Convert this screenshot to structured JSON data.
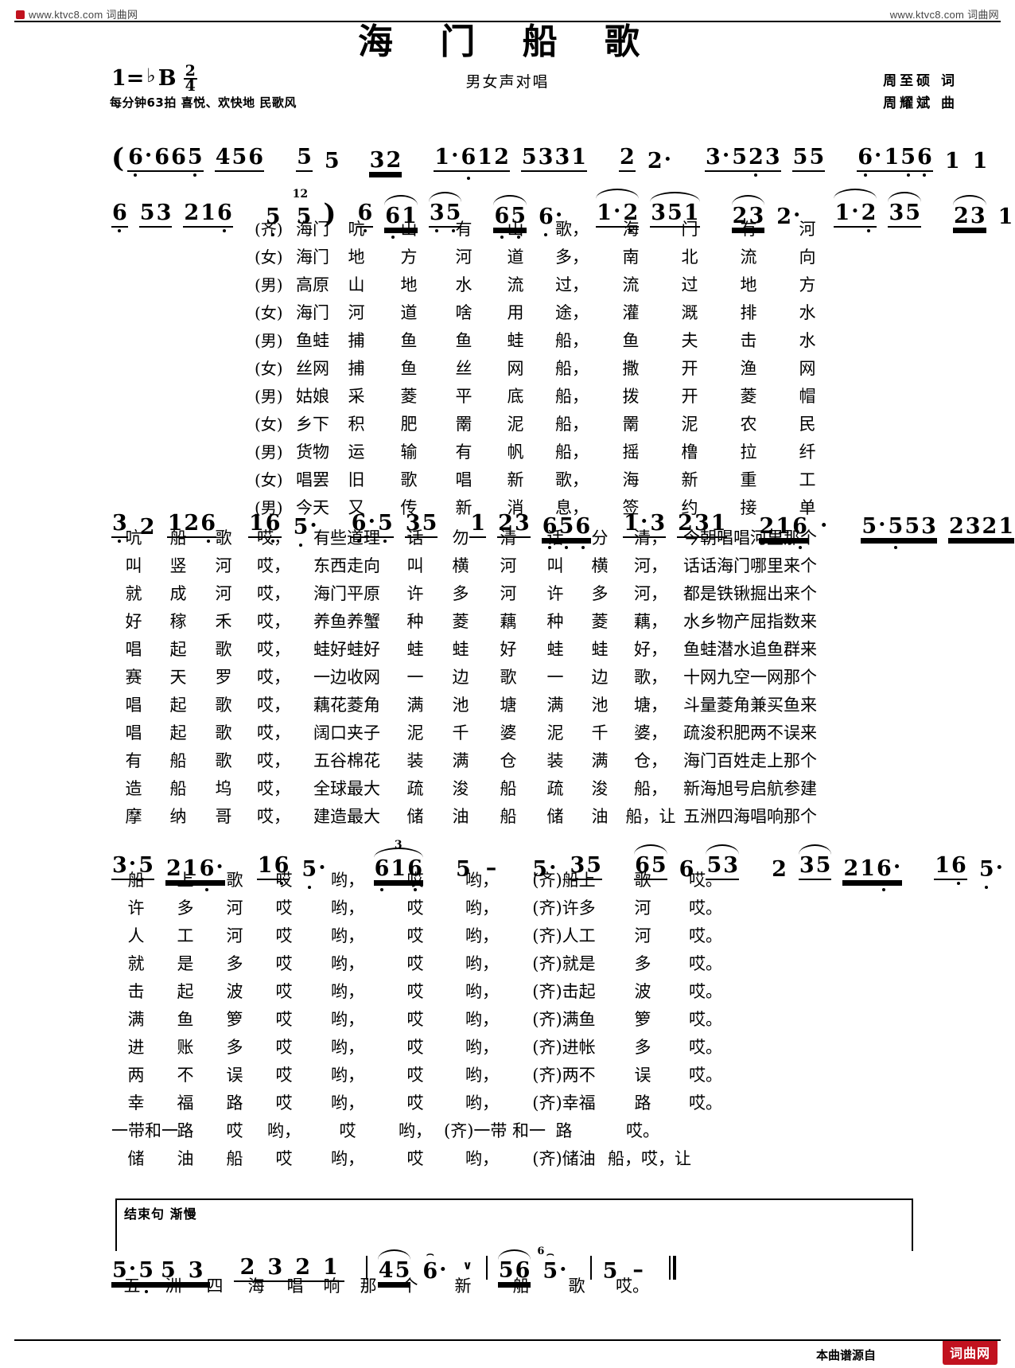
{
  "watermark": {
    "left": "www.ktvc8.com 词曲网",
    "right": "www.ktvc8.com 词曲网"
  },
  "header": {
    "title": "海 门 船 歌",
    "subtitle": "男女声对唱",
    "key": "1=",
    "key_accidental": "♭",
    "key_letter": "B",
    "meter_num": "2",
    "meter_den": "4",
    "tempo": "每分钟63拍 喜悦、欢快地 民歌风",
    "lyricist": "周至硕  词",
    "composer": "周耀斌  曲"
  },
  "chart_data": {
    "type": "table",
    "title": "海 门 船 歌",
    "notation": "jianpu",
    "systems": [
      {
        "id": "intro-1",
        "measures": [
          "(6·665 456",
          "5 5  32",
          "1·612 5331",
          "2 2·",
          "3·523 5 5",
          "6·156 1 1"
        ]
      },
      {
        "id": "intro-2",
        "measures": [
          "6 53 216",
          "5  12 5)",
          "6 61 3 5",
          "65 6·",
          "1· 2 351",
          "23 2·",
          "1· 2 3 5",
          "23 1·"
        ]
      },
      {
        "id": "verse-a",
        "measures": [
          "3 2 126",
          "16 5·",
          "6·5 3 5",
          "1 23 656",
          "1·3 231",
          "216·",
          "5·553 2321"
        ]
      },
      {
        "id": "verse-b",
        "measures": [
          "3·5 216·",
          "16 5·",
          "616",
          "5  -",
          "5· 35",
          "65 6  53",
          "2 35 216·",
          "16 5·"
        ]
      },
      {
        "id": "coda",
        "measures": [
          "5·5 5 3",
          "2 3 2 1",
          "4 5 6·",
          "5 6 5·",
          "5  -"
        ]
      }
    ]
  },
  "staff1": {
    "cells": [
      {
        "t": "(",
        "type": "paren"
      },
      {
        "t": "6",
        "beam": 1,
        "dot": "aug"
      },
      {
        "t": "6",
        "beam": 1
      },
      {
        "t": "6",
        "beam": 1
      },
      {
        "t": "5",
        "beam": 1,
        "low": 1
      },
      {
        "t": "4",
        "beam": 1
      },
      {
        "t": "5",
        "beam": 1
      },
      {
        "t": "6",
        "beam": 1
      },
      {
        "t": "|"
      },
      {
        "t": "5",
        "beam": 1
      },
      {
        "t": "5"
      },
      {
        "t": "3",
        "beam": 2
      },
      {
        "t": "2",
        "beam": 2
      },
      {
        "t": "|"
      },
      {
        "t": "1",
        "beam": 1,
        "dot": "aug"
      },
      {
        "t": "6",
        "beam": 1,
        "low": 1
      },
      {
        "t": "1",
        "beam": 1
      },
      {
        "t": "2",
        "beam": 1
      },
      {
        "t": "5",
        "beam": 1
      },
      {
        "t": "3",
        "beam": 1
      },
      {
        "t": "3",
        "beam": 1
      },
      {
        "t": "1",
        "beam": 1
      },
      {
        "t": "|"
      },
      {
        "t": "2",
        "beam": 1
      },
      {
        "t": "2",
        "dot": "aug"
      },
      {
        "t": "|"
      },
      {
        "t": "3",
        "beam": 1,
        "dot": "aug"
      },
      {
        "t": "5",
        "beam": 1
      },
      {
        "t": "2",
        "beam": 1,
        "low": 1
      },
      {
        "t": "3",
        "beam": 1
      },
      {
        "t": "5",
        "beam": 1
      },
      {
        "t": "5",
        "beam": 1
      },
      {
        "t": "|"
      },
      {
        "t": "6",
        "beam": 1,
        "dot": "aug",
        "low": 1
      },
      {
        "t": "1",
        "beam": 1,
        "lowbar": 1
      },
      {
        "t": "5",
        "beam": 1,
        "low": 1
      },
      {
        "t": "6",
        "beam": 1,
        "low": 1
      },
      {
        "t": "1"
      },
      {
        "t": "1"
      },
      {
        "t": "|"
      }
    ]
  },
  "staff2_text": "6 53 216 | 5 12 5) | 6 61 3 5 | 65 6· | 1· 2 351 | 23 2· | 1· 2 3 5 | 23 1· |",
  "lyricblock1": {
    "columns": 11,
    "rows": [
      {
        "role": "(齐)",
        "cells": [
          "海门",
          "吭",
          "山",
          "有",
          "山",
          "歌，",
          "海",
          "门",
          "有",
          "河"
        ]
      },
      {
        "role": "(女)",
        "cells": [
          "海门",
          "地",
          "方",
          "河",
          "道",
          "多，",
          "南",
          "北",
          "流",
          "向"
        ]
      },
      {
        "role": "(男)",
        "cells": [
          "高原",
          "山",
          "地",
          "水",
          "流",
          "过，",
          "流",
          "过",
          "地",
          "方"
        ]
      },
      {
        "role": "(女)",
        "cells": [
          "海门",
          "河",
          "道",
          "啥",
          "用",
          "途，",
          "灌",
          "溉",
          "排",
          "水"
        ]
      },
      {
        "role": "(男)",
        "cells": [
          "鱼蛙",
          "捕",
          "鱼",
          "鱼",
          "蛙",
          "船，",
          "鱼",
          "夫",
          "击",
          "水"
        ]
      },
      {
        "role": "(女)",
        "cells": [
          "丝网",
          "捕",
          "鱼",
          "丝",
          "网",
          "船，",
          "撒",
          "开",
          "渔",
          "网"
        ]
      },
      {
        "role": "(男)",
        "cells": [
          "姑娘",
          "采",
          "菱",
          "平",
          "底",
          "船，",
          "拨",
          "开",
          "菱",
          "帽"
        ]
      },
      {
        "role": "(女)",
        "cells": [
          "乡下",
          "积",
          "肥",
          "罱",
          "泥",
          "船，",
          "罱",
          "泥",
          "农",
          "民"
        ]
      },
      {
        "role": "(男)",
        "cells": [
          "货物",
          "运",
          "输",
          "有",
          "帆",
          "船，",
          "摇",
          "橹",
          "拉",
          "纤"
        ]
      },
      {
        "role": "(女)",
        "cells": [
          "唱罢",
          "旧",
          "歌",
          "唱",
          "新",
          "歌，",
          "海",
          "新",
          "重",
          "工"
        ]
      },
      {
        "role": "(男)",
        "cells": [
          "今天",
          "又",
          "传",
          "新",
          "消",
          "息，",
          "签",
          "约",
          "接",
          "单"
        ]
      }
    ]
  },
  "staff3_text": "3 2 126 | 16 5· | 6·5 3 5 | 1 23 656 | 1·3 231 | 216· | 5·553 2321 |",
  "lyricblock2": {
    "rows": [
      {
        "cells": [
          "吭",
          "船",
          "歌",
          "哎，",
          "有些道理",
          "话",
          "勿",
          "清",
          "话",
          "分",
          "清，",
          "今朝唱唱河里那个"
        ]
      },
      {
        "cells": [
          "叫",
          "竖",
          "河",
          "哎，",
          "东西走向",
          "叫",
          "横",
          "河",
          "叫",
          "横",
          "河，",
          "话话海门哪里来个"
        ]
      },
      {
        "cells": [
          "就",
          "成",
          "河",
          "哎，",
          "海门平原",
          "许",
          "多",
          "河",
          "许",
          "多",
          "河，",
          "都是铁锹掘出来个"
        ]
      },
      {
        "cells": [
          "好",
          "稼",
          "禾",
          "哎，",
          "养鱼养蟹",
          "种",
          "菱",
          "藕",
          "种",
          "菱",
          "藕，",
          "水乡物产屈指数来"
        ]
      },
      {
        "cells": [
          "唱",
          "起",
          "歌",
          "哎，",
          "蛙好蛙好",
          "蛙",
          "蛙",
          "好",
          "蛙",
          "蛙",
          "好，",
          "鱼蛙潜水追鱼群来"
        ]
      },
      {
        "cells": [
          "赛",
          "天",
          "罗",
          "哎，",
          "一边收网",
          "一",
          "边",
          "歌",
          "一",
          "边",
          "歌，",
          "十网九空一网那个"
        ]
      },
      {
        "cells": [
          "唱",
          "起",
          "歌",
          "哎，",
          "藕花菱角",
          "满",
          "池",
          "塘",
          "满",
          "池",
          "塘，",
          "斗量菱角兼买鱼来"
        ]
      },
      {
        "cells": [
          "唱",
          "起",
          "歌",
          "哎，",
          "阔口夹子",
          "泥",
          "千",
          "婆",
          "泥",
          "千",
          "婆，",
          "疏浚积肥两不误来"
        ]
      },
      {
        "cells": [
          "有",
          "船",
          "歌",
          "哎，",
          "五谷棉花",
          "装",
          "满",
          "仓",
          "装",
          "满",
          "仓，",
          "海门百姓走上那个"
        ]
      },
      {
        "cells": [
          "造",
          "船",
          "坞",
          "哎，",
          "全球最大",
          "疏",
          "浚",
          "船",
          "疏",
          "浚",
          "船，",
          "新海旭号启航参建"
        ]
      },
      {
        "cells": [
          "摩",
          "纳",
          "哥",
          "哎，",
          "建造最大",
          "储",
          "油",
          "船",
          "储",
          "油",
          "船，让",
          "五洲四海唱响那个"
        ]
      }
    ]
  },
  "staff4_text": "3·5 216· | 16 5· | 616 | 5 - | 5· 35 | 65 6 53 | 2 35 216· | 16 5· :|",
  "lyricblock3": {
    "rows": [
      {
        "cells": [
          "船",
          "上",
          "歌",
          "哎",
          "哟，",
          "哎",
          "哟，",
          "(齐)船上",
          "歌",
          "哎。"
        ]
      },
      {
        "cells": [
          "许",
          "多",
          "河",
          "哎",
          "哟，",
          "哎",
          "哟，",
          "(齐)许多",
          "河",
          "哎。"
        ]
      },
      {
        "cells": [
          "人",
          "工",
          "河",
          "哎",
          "哟，",
          "哎",
          "哟，",
          "(齐)人工",
          "河",
          "哎。"
        ]
      },
      {
        "cells": [
          "就",
          "是",
          "多",
          "哎",
          "哟，",
          "哎",
          "哟，",
          "(齐)就是",
          "多",
          "哎。"
        ]
      },
      {
        "cells": [
          "击",
          "起",
          "波",
          "哎",
          "哟，",
          "哎",
          "哟，",
          "(齐)击起",
          "波",
          "哎。"
        ]
      },
      {
        "cells": [
          "满",
          "鱼",
          "箩",
          "哎",
          "哟，",
          "哎",
          "哟，",
          "(齐)满鱼",
          "箩",
          "哎。"
        ]
      },
      {
        "cells": [
          "进",
          "账",
          "多",
          "哎",
          "哟，",
          "哎",
          "哟，",
          "(齐)进帐",
          "多",
          "哎。"
        ]
      },
      {
        "cells": [
          "两",
          "不",
          "误",
          "哎",
          "哟，",
          "哎",
          "哟，",
          "(齐)两不",
          "误",
          "哎。"
        ]
      },
      {
        "cells": [
          "幸",
          "福",
          "路",
          "哎",
          "哟，",
          "哎",
          "哟，",
          "(齐)幸福",
          "路",
          "哎。"
        ]
      },
      {
        "cells": [
          "一带和一",
          "路",
          "哎",
          "哟，",
          "哎",
          "哟，",
          "(齐)一带 和一",
          "路",
          "哎。"
        ]
      },
      {
        "cells": [
          "储",
          "油",
          "船",
          "哎",
          "哟，",
          "哎",
          "哟，",
          "(齐)储油",
          "船，哎，让"
        ]
      }
    ]
  },
  "coda": {
    "label": "结束句  渐慢",
    "lyrics": [
      "五",
      "洲",
      "四",
      "海",
      "唱",
      "响",
      "那",
      "个",
      "新",
      "船",
      "歌",
      "哎。"
    ]
  },
  "footer": {
    "source": "本曲谱源自",
    "badge": "词曲网"
  }
}
